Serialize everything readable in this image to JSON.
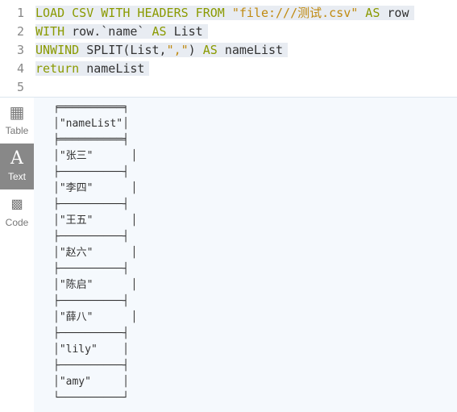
{
  "editor": {
    "line_numbers": [
      "1",
      "2",
      "3",
      "4",
      "5"
    ],
    "lines": [
      [
        {
          "t": "LOAD CSV WITH HEADERS FROM ",
          "c": "kw"
        },
        {
          "t": "\"file:///测试.csv\"",
          "c": "str"
        },
        {
          "t": " AS ",
          "c": "kw"
        },
        {
          "t": "row",
          "c": ""
        }
      ],
      [
        {
          "t": "WITH ",
          "c": "kw"
        },
        {
          "t": "row.`name` ",
          "c": ""
        },
        {
          "t": "AS ",
          "c": "kw"
        },
        {
          "t": "List",
          "c": ""
        }
      ],
      [
        {
          "t": "UNWIND ",
          "c": "kw"
        },
        {
          "t": "SPLIT(List,",
          "c": ""
        },
        {
          "t": "\",\"",
          "c": "str"
        },
        {
          "t": ") ",
          "c": ""
        },
        {
          "t": "AS ",
          "c": "kw"
        },
        {
          "t": "nameList",
          "c": ""
        }
      ],
      [
        {
          "t": "return ",
          "c": "kw"
        },
        {
          "t": "nameList",
          "c": ""
        }
      ],
      []
    ]
  },
  "sidebar": {
    "items": [
      {
        "label": "Table",
        "icon": "table-icon"
      },
      {
        "label": "Text",
        "icon": "text-icon",
        "active": true
      },
      {
        "label": "Code",
        "icon": "code-icon"
      }
    ]
  },
  "result": {
    "header": "\"nameList\"",
    "rows": [
      "\"张三\"",
      "\"李四\"",
      "\"王五\"",
      "\"赵六\"",
      "\"陈启\"",
      "\"薛八\"",
      "\"lily\"",
      "\"amy\""
    ],
    "text": "╒══════════╕\n│\"nameList\"│\n╞══════════╡\n│\"张三\"      │\n├──────────┤\n│\"李四\"      │\n├──────────┤\n│\"王五\"      │\n├──────────┤\n│\"赵六\"      │\n├──────────┤\n│\"陈启\"      │\n├──────────┤\n│\"薛八\"      │\n├──────────┤\n│\"lily\"    │\n├──────────┤\n│\"amy\"     │\n└──────────┘"
  }
}
